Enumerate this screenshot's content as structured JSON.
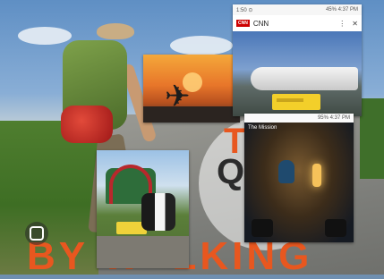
{
  "collage": {
    "overlay_text_bottom": "BY W  LKING",
    "overlay_text_right_1": "TH",
    "overlay_text_right_2": "Q",
    "overlay_color": "#e8571f"
  },
  "news_screenshot": {
    "status_left": "1:50 ⊙",
    "status_right": "45% 4:37 PM",
    "app_logo": "CNN",
    "app_title": "CNN",
    "icons": [
      "share-icon",
      "more-icon",
      "close-icon"
    ]
  },
  "car_screenshot": {
    "status_left": "",
    "status_right": "95% 4:37 PM",
    "photo_caption": "The Mission"
  },
  "icons": {
    "lens": "google-lens-icon"
  }
}
